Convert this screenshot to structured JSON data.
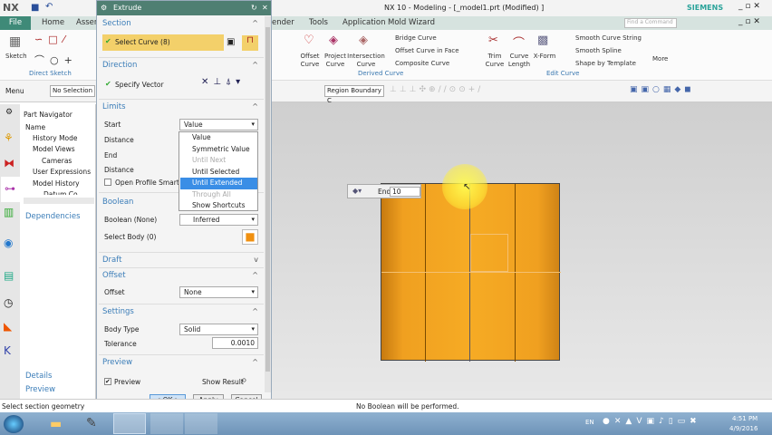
{
  "app": {
    "logo": "NX",
    "title": "NX 10 - Modeling - [_model1.prt (Modified) ]",
    "brand": "SIEMENS",
    "find_placeholder": "Find a Command"
  },
  "menu": {
    "file": "File",
    "items": [
      "Home",
      "Assen",
      "ender",
      "Tools",
      "Application",
      "Mold Wizard"
    ]
  },
  "ribbon": {
    "sketch": "Sketch",
    "direct_sketch": "Direct Sketch",
    "offset_curve": "Offset Curve",
    "project_curve": "Project Curve",
    "intersection_curve": "Intersection Curve",
    "bridge_curve": "Bridge Curve",
    "offset_in_face": "Offset Curve in Face",
    "composite_curve": "Composite Curve",
    "derived_curve": "Derived Curve",
    "trim_curve": "Trim Curve",
    "curve_length": "Curve Length",
    "xform": "X-Form",
    "smooth_string": "Smooth Curve String",
    "smooth_spline": "Smooth Spline",
    "shape_template": "Shape by Template",
    "edit_curve": "Edit Curve",
    "more": "More"
  },
  "toolbar": {
    "menu": "Menu",
    "selection_filter": "No Selection F",
    "region": "Region Boundary C"
  },
  "navigator": {
    "title": "Part Navigator",
    "column": "Name",
    "items": [
      "History Mode",
      "Model Views",
      "Cameras",
      "User Expressions",
      "Model History",
      "Datum Co"
    ],
    "dependencies": "Dependencies",
    "details": "Details",
    "preview": "Preview"
  },
  "dialog": {
    "title": "Extrude",
    "section": {
      "label": "Section",
      "select_curve": "Select Curve (8)"
    },
    "direction": {
      "label": "Direction",
      "specify_vector": "Specify Vector"
    },
    "limits": {
      "label": "Limits",
      "start": "Start",
      "start_value": "Value",
      "distance": "Distance",
      "end": "End",
      "distance2": "Distance",
      "open_profile": "Open Profile Smart Vo"
    },
    "dropdown": [
      "Value",
      "Symmetric Value",
      "Until Next",
      "Until Selected",
      "Until Extended",
      "Through All",
      "Show Shortcuts"
    ],
    "boolean": {
      "label": "Boolean",
      "boolean_label": "Boolean (None)",
      "boolean_value": "Inferred",
      "select_body": "Select Body (0)"
    },
    "draft": {
      "label": "Draft"
    },
    "offset": {
      "label": "Offset",
      "offset_label": "Offset",
      "offset_value": "None"
    },
    "settings": {
      "label": "Settings",
      "body_type": "Body Type",
      "body_type_value": "Solid",
      "tolerance": "Tolerance",
      "tolerance_value": "0.0010"
    },
    "preview": {
      "label": "Preview",
      "preview": "Preview",
      "show_result": "Show Result"
    },
    "ok": "< OK >",
    "apply": "Apply",
    "cancel": "Cancel"
  },
  "viewport": {
    "end_label": "End",
    "end_value": "10"
  },
  "status": {
    "left": "Select section geometry",
    "center": "No Boolean will be performed."
  },
  "taskbar": {
    "lang": "EN",
    "time": "4:51 PM",
    "date": "4/9/2016"
  },
  "colors": {
    "accent": "#3f8a78",
    "model": "#f0a020",
    "highlight": "#3a8ee6"
  }
}
